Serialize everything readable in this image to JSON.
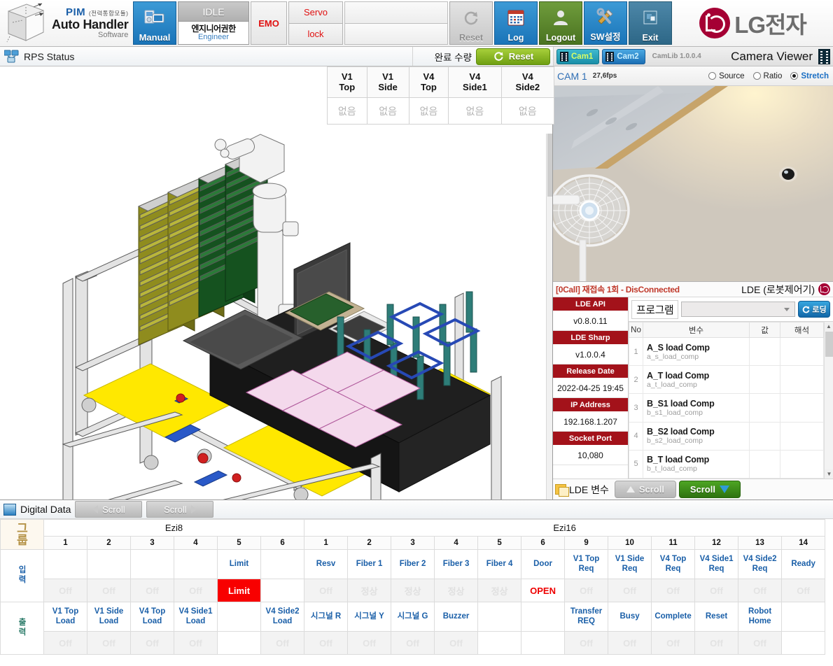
{
  "header": {
    "logo": {
      "line1": "PIM",
      "line1_kr": "(전력통합모듈)",
      "line2": "Auto Handler",
      "line3": "Software"
    },
    "manual_button": "Manual",
    "status_top": "IDLE",
    "auth_kr": "엔지니어권한",
    "auth_en": "Engineer",
    "emo": "EMO",
    "servo": "Servo",
    "lock": "lock",
    "buttons": [
      {
        "label": "Reset",
        "icon": "refresh-icon"
      },
      {
        "label": "Log",
        "icon": "calendar-icon"
      },
      {
        "label": "Logout",
        "icon": "user-icon"
      },
      {
        "label": "SW설정",
        "icon": "tools-icon"
      },
      {
        "label": "Exit",
        "icon": "exit-icon"
      }
    ],
    "brand": "LG전자"
  },
  "statusbar": {
    "rps_title": "RPS Status",
    "qty_label": "완료 수량",
    "qty_reset": "Reset",
    "cam1": "Cam1",
    "cam2": "Cam2",
    "camlib": "CamLib 1.0.0.4",
    "viewer_title": "Camera Viewer"
  },
  "vision_table": {
    "headers": [
      "V1\nTop",
      "V1\nSide",
      "V4\nTop",
      "V4\nSide1",
      "V4\nSide2"
    ],
    "header_lines": [
      [
        "V1",
        "Top"
      ],
      [
        "V1",
        "Side"
      ],
      [
        "V4",
        "Top"
      ],
      [
        "V4",
        "Side1"
      ],
      [
        "V4",
        "Side2"
      ]
    ],
    "values": [
      "없음",
      "없음",
      "없음",
      "없음",
      "없음"
    ]
  },
  "camera": {
    "name": "CAM 1",
    "fps": "27,6fps",
    "modes": [
      {
        "label": "Source",
        "selected": false
      },
      {
        "label": "Ratio",
        "selected": false
      },
      {
        "label": "Stretch",
        "selected": true
      }
    ]
  },
  "lde": {
    "error_status": "[0Call] 재접속 1회 - DisConnected",
    "title": "LDE (로봇제어기)",
    "info": [
      {
        "label": "LDE API",
        "value": "v0.8.0.11"
      },
      {
        "label": "LDE Sharp",
        "value": "v1.0.0.4"
      },
      {
        "label": "Release Date",
        "value": "2022-04-25 19:45"
      },
      {
        "label": "IP Address",
        "value": "192.168.1.207"
      },
      {
        "label": "Socket Port",
        "value": "10,080"
      }
    ],
    "program_label": "프로그램",
    "program_value": "",
    "load_button": "로딩",
    "table_headers": [
      "No",
      "변수",
      "값",
      "해석"
    ],
    "rows": [
      {
        "no": "1",
        "name": "A_S load Comp",
        "key": "a_s_load_comp",
        "value": "",
        "desc": ""
      },
      {
        "no": "2",
        "name": "A_T load Comp",
        "key": "a_t_load_comp",
        "value": "",
        "desc": ""
      },
      {
        "no": "3",
        "name": "B_S1 load Comp",
        "key": "b_s1_load_comp",
        "value": "",
        "desc": ""
      },
      {
        "no": "4",
        "name": "B_S2 load Comp",
        "key": "b_s2_load_comp",
        "value": "",
        "desc": ""
      },
      {
        "no": "5",
        "name": "B_T load Comp",
        "key": "b_t_load_comp",
        "value": "",
        "desc": ""
      }
    ],
    "footer_label": "LDE 변수",
    "scroll_up": "Scroll",
    "scroll_down": "Scroll"
  },
  "digital_data": {
    "title": "Digital Data",
    "scroll_left": "Scroll",
    "scroll_right": "Scroll",
    "group_header": "그룹",
    "input_header": "입력",
    "output_header": "출력",
    "groups": [
      {
        "name": "Ezi8",
        "columns": [
          "1",
          "2",
          "3",
          "4",
          "5",
          "6"
        ]
      },
      {
        "name": "Ezi16",
        "columns": [
          "1",
          "2",
          "3",
          "4",
          "5",
          "6",
          "9",
          "10",
          "11",
          "12",
          "13",
          "14"
        ]
      }
    ],
    "ezi8": {
      "input_labels": [
        "",
        "",
        "",
        "",
        "Limit",
        ""
      ],
      "input_values": [
        "Off",
        "Off",
        "Off",
        "Off",
        "Limit",
        ""
      ],
      "input_states": [
        "off",
        "off",
        "off",
        "off",
        "alarm",
        "empty"
      ],
      "output_labels": [
        "V1 Top\nLoad",
        "V1 Side\nLoad",
        "V4 Top\nLoad",
        "V4 Side1\nLoad",
        "",
        "V4 Side2\nLoad"
      ],
      "output_label_lines": [
        [
          "V1 Top",
          "Load"
        ],
        [
          "V1 Side",
          "Load"
        ],
        [
          "V4 Top",
          "Load"
        ],
        [
          "V4 Side1",
          "Load"
        ],
        [
          "",
          ""
        ],
        [
          "V4 Side2",
          "Load"
        ]
      ],
      "output_values": [
        "Off",
        "Off",
        "Off",
        "Off",
        "",
        "Off"
      ],
      "output_states": [
        "off",
        "off",
        "off",
        "off",
        "empty",
        "off"
      ]
    },
    "ezi16": {
      "input_labels": [
        "Resv",
        "Fiber 1",
        "Fiber 2",
        "Fiber 3",
        "Fiber 4",
        "Door",
        "V1 Top\nReq",
        "V1 Side\nReq",
        "V4 Top\nReq",
        "V4 Side1\nReq",
        "V4 Side2\nReq",
        "Ready"
      ],
      "input_label_lines": [
        [
          "",
          "Resv"
        ],
        [
          "",
          "Fiber 1"
        ],
        [
          "",
          "Fiber 2"
        ],
        [
          "",
          "Fiber 3"
        ],
        [
          "",
          "Fiber 4"
        ],
        [
          "",
          "Door"
        ],
        [
          "V1 Top",
          "Req"
        ],
        [
          "V1 Side",
          "Req"
        ],
        [
          "V4 Top",
          "Req"
        ],
        [
          "V4 Side1",
          "Req"
        ],
        [
          "V4 Side2",
          "Req"
        ],
        [
          "",
          "Ready"
        ]
      ],
      "input_values": [
        "Off",
        "정상",
        "정상",
        "정상",
        "정상",
        "OPEN",
        "Off",
        "Off",
        "Off",
        "Off",
        "Off",
        "Off"
      ],
      "input_states": [
        "off",
        "kr",
        "kr",
        "kr",
        "kr",
        "open",
        "off",
        "off",
        "off",
        "off",
        "off",
        "off"
      ],
      "output_labels": [
        "시그널 R",
        "시그널 Y",
        "시그널 G",
        "Buzzer",
        "",
        "",
        "Transfer\nREQ",
        "Busy",
        "Complete",
        "Reset",
        "Robot\nHome",
        ""
      ],
      "output_label_lines": [
        [
          "",
          "시그널 R"
        ],
        [
          "",
          "시그널 Y"
        ],
        [
          "",
          "시그널 G"
        ],
        [
          "",
          "Buzzer"
        ],
        [
          "",
          ""
        ],
        [
          "",
          ""
        ],
        [
          "Transfer",
          "REQ"
        ],
        [
          "",
          "Busy"
        ],
        [
          "",
          "Complete"
        ],
        [
          "",
          "Reset"
        ],
        [
          "Robot",
          "Home"
        ],
        [
          "",
          ""
        ]
      ],
      "output_values": [
        "Off",
        "Off",
        "Off",
        "Off",
        "",
        "",
        "Off",
        "Off",
        "Off",
        "Off",
        "Off",
        ""
      ],
      "output_states": [
        "off",
        "off",
        "off",
        "off",
        "empty",
        "empty",
        "off",
        "off",
        "off",
        "off",
        "off",
        "empty"
      ]
    }
  },
  "colors": {
    "accent_blue": "#1a74b8",
    "brand_red": "#a50034",
    "alarm_red": "#f80000",
    "lde_red": "#a3121a",
    "label_blue": "#1a5fa8",
    "green": "#4ea524"
  }
}
